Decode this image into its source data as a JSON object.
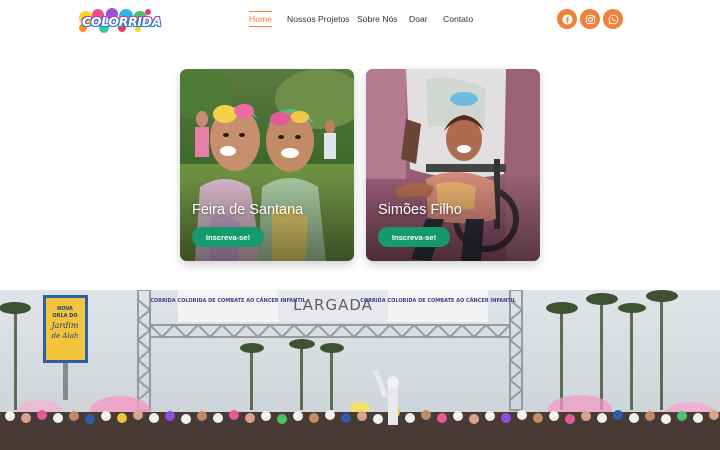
{
  "brand": {
    "logo_text": "COLORRIDA"
  },
  "nav": {
    "items": [
      {
        "label": "Home",
        "active": true
      },
      {
        "label": "Nossos Projetos",
        "active": false
      },
      {
        "label": "Sobre Nós",
        "active": false
      },
      {
        "label": "Doar",
        "active": false
      },
      {
        "label": "Contato",
        "active": false
      }
    ]
  },
  "social": {
    "icons": [
      "facebook-icon",
      "instagram-icon",
      "whatsapp-icon"
    ]
  },
  "cards": [
    {
      "title": "Feira de Santana",
      "button_label": "Inscreva-se!"
    },
    {
      "title": "Simões Filho",
      "button_label": "Inscreva-se!"
    }
  ],
  "hero": {
    "banner_left": "CORRIDA COLORIDA DE COMBATE AO CÂNCER INFANTIL",
    "banner_center": "LARGADA",
    "banner_right": "CORRIDA COLORIDA DE COMBATE AO CÂNCER INFANTIL",
    "billboard_lines": [
      "NOVA",
      "ORLA DO",
      "Jardim",
      "de Alah"
    ]
  },
  "colors": {
    "accent": "#f0813a",
    "button": "#159a6c",
    "nav_text": "#333333"
  }
}
